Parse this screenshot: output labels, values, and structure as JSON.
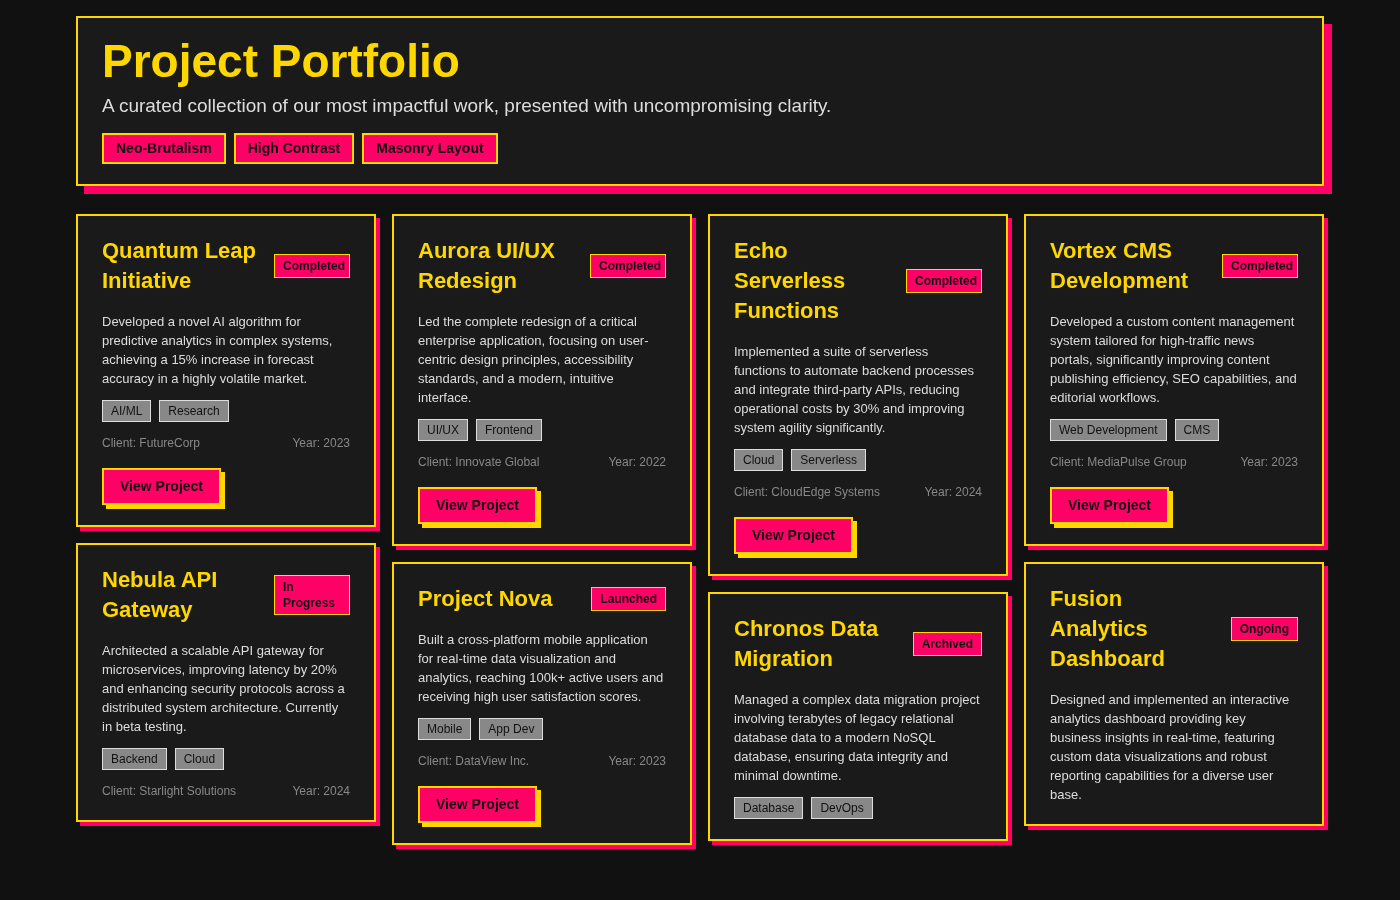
{
  "header": {
    "title": "Project Portfolio",
    "subtitle": "A curated collection of our most impactful work, presented with uncompromising clarity.",
    "tags": [
      "Neo-Brutalism",
      "High Contrast",
      "Masonry Layout"
    ]
  },
  "columns": [
    [
      {
        "title": "Quantum Leap Initiative",
        "status": "Completed",
        "description": "Developed a novel AI algorithm for predictive analytics in complex systems, achieving a 15% increase in forecast accuracy in a highly volatile market.",
        "tags": [
          "AI/ML",
          "Research"
        ],
        "client": "Client: FutureCorp",
        "year": "Year: 2023",
        "button": "View Project"
      },
      {
        "title": "Nebula API Gateway",
        "status": "In Progress",
        "description": "Architected a scalable API gateway for microservices, improving latency by 20% and enhancing security protocols across a distributed system architecture. Currently in beta testing.",
        "tags": [
          "Backend",
          "Cloud"
        ],
        "client": "Client: Starlight Solutions",
        "year": "Year: 2024"
      }
    ],
    [
      {
        "title": "Aurora UI/UX Redesign",
        "status": "Completed",
        "description": "Led the complete redesign of a critical enterprise application, focusing on user-centric design principles, accessibility standards, and a modern, intuitive interface.",
        "tags": [
          "UI/UX",
          "Frontend"
        ],
        "client": "Client: Innovate Global",
        "year": "Year: 2022",
        "button": "View Project"
      },
      {
        "title": "Project Nova",
        "status": "Launched",
        "description": "Built a cross-platform mobile application for real-time data visualization and analytics, reaching 100k+ active users and receiving high user satisfaction scores.",
        "tags": [
          "Mobile",
          "App Dev"
        ],
        "client": "Client: DataView Inc.",
        "year": "Year: 2023",
        "button": "View Project"
      }
    ],
    [
      {
        "title": "Echo Serverless Functions",
        "status": "Completed",
        "description": "Implemented a suite of serverless functions to automate backend processes and integrate third-party APIs, reducing operational costs by 30% and improving system agility significantly.",
        "tags": [
          "Cloud",
          "Serverless"
        ],
        "client": "Client: CloudEdge Systems",
        "year": "Year: 2024",
        "button": "View Project"
      },
      {
        "title": "Chronos Data Migration",
        "status": "Archived",
        "description": "Managed a complex data migration project involving terabytes of legacy relational database data to a modern NoSQL database, ensuring data integrity and minimal downtime.",
        "tags": [
          "Database",
          "DevOps"
        ]
      }
    ],
    [
      {
        "title": "Vortex CMS Development",
        "status": "Completed",
        "description": "Developed a custom content management system tailored for high-traffic news portals, significantly improving content publishing efficiency, SEO capabilities, and editorial workflows.",
        "tags": [
          "Web Development",
          "CMS"
        ],
        "client": "Client: MediaPulse Group",
        "year": "Year: 2023",
        "button": "View Project"
      },
      {
        "title": "Fusion Analytics Dashboard",
        "status": "Ongoing",
        "description": "Designed and implemented an interactive analytics dashboard providing key business insights in real-time, featuring custom data visualizations and robust reporting capabilities for a diverse user base."
      }
    ]
  ]
}
